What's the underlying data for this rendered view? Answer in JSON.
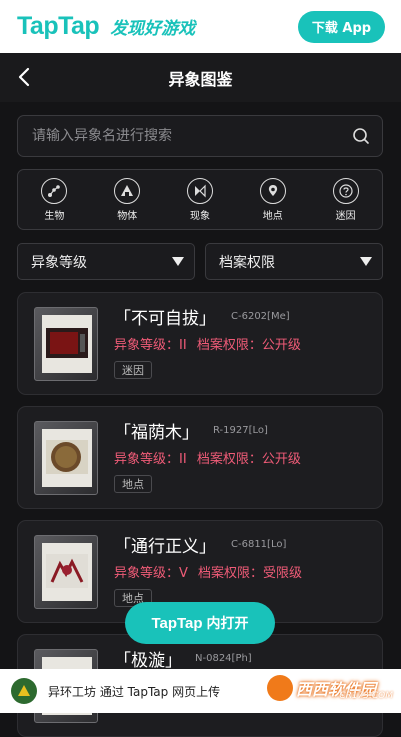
{
  "header": {
    "logo_text": "TapTap",
    "slogan": "发现好游戏",
    "download_label": "下载 App"
  },
  "nav": {
    "title": "异象图鉴",
    "back_icon": "chevron-left-icon"
  },
  "search": {
    "placeholder": "请输入异象名进行搜索",
    "value": "",
    "icon": "search-icon"
  },
  "categories": [
    {
      "label": "生物",
      "icon": "creature-icon"
    },
    {
      "label": "物体",
      "icon": "object-icon"
    },
    {
      "label": "现象",
      "icon": "phenomenon-icon"
    },
    {
      "label": "地点",
      "icon": "location-icon"
    },
    {
      "label": "迷因",
      "icon": "meme-icon"
    }
  ],
  "filters": [
    {
      "label": "异象等级"
    },
    {
      "label": "档案权限"
    }
  ],
  "cards": [
    {
      "name": "「不可自拔」",
      "code": "C-6202[Me]",
      "level": "异象等级：II",
      "access": "档案权限：公开级",
      "tag": "迷因"
    },
    {
      "name": "「福荫木」",
      "code": "R-1927[Lo]",
      "level": "异象等级：II",
      "access": "档案权限：公开级",
      "tag": "地点"
    },
    {
      "name": "「通行正义」",
      "code": "C-6811[Lo]",
      "level": "异象等级：V",
      "access": "档案权限：受限级",
      "tag": "地点"
    },
    {
      "name": "「极漩」",
      "code": "N-0824[Ph]",
      "level": "",
      "access": "",
      "tag": ""
    }
  ],
  "open_in_app": {
    "brand": "TapTap",
    "label": "内打开"
  },
  "bottom_bar": {
    "text": "异环工坊 通过 TapTap 网页上传"
  },
  "watermark": {
    "text": "西西软件园",
    "sub": "CR173.COM"
  },
  "colors": {
    "accent": "#19c2ba",
    "danger": "#ef5b77",
    "background": "#141416"
  }
}
